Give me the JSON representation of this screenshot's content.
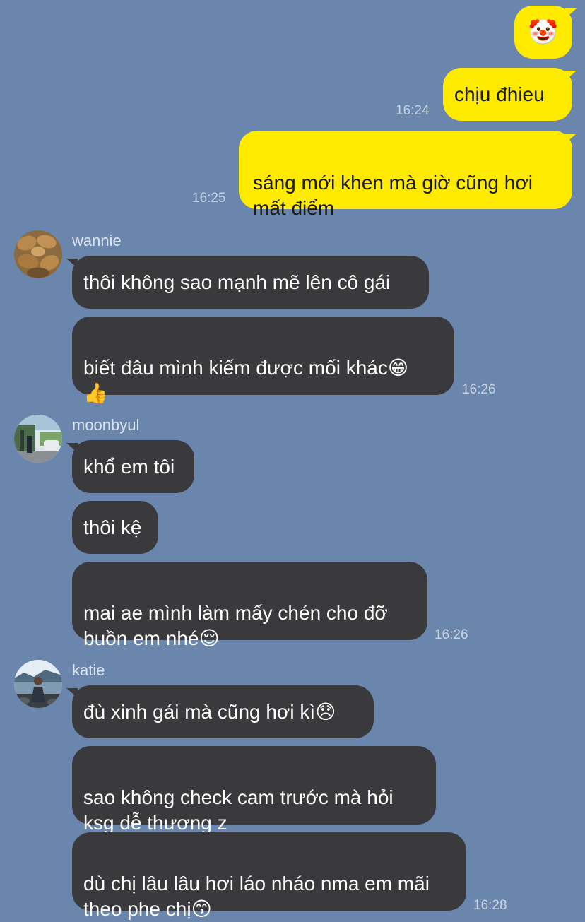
{
  "messages": {
    "sent": [
      {
        "text": "🤡",
        "time": ""
      },
      {
        "text": "chịu đhieu",
        "time": "16:24"
      },
      {
        "text": "sáng mới khen mà giờ cũng hơi\nmất điểm",
        "time": "16:25"
      }
    ],
    "wannie": {
      "name": "wannie",
      "bubbles": [
        "thôi không sao mạnh mẽ lên cô gái",
        "biết đâu mình kiếm được mối khác😁\n👍"
      ],
      "time": "16:26"
    },
    "moonbyul": {
      "name": "moonbyul",
      "bubbles": [
        "khổ em tôi",
        "thôi kệ",
        "mai ae mình làm mấy chén cho đỡ\nbuồn em nhé😌"
      ],
      "time": "16:26"
    },
    "katie": {
      "name": "katie",
      "bubbles": [
        "đù xinh gái mà cũng hơi kì😞",
        "sao không check cam trước mà hỏi\nksg dễ thương z",
        "dù chị lâu lâu hơi láo nháo nma em mãi\ntheo phe chị😙"
      ],
      "time": "16:28"
    }
  },
  "colors": {
    "background": "#6B86AD",
    "sent_bubble": "#FFEB00",
    "received_bubble": "#3A3A3C"
  },
  "icons": {
    "wannie_avatar": "food-photo-avatar",
    "moonbyul_avatar": "street-photo-avatar",
    "katie_avatar": "seaside-photo-avatar"
  }
}
